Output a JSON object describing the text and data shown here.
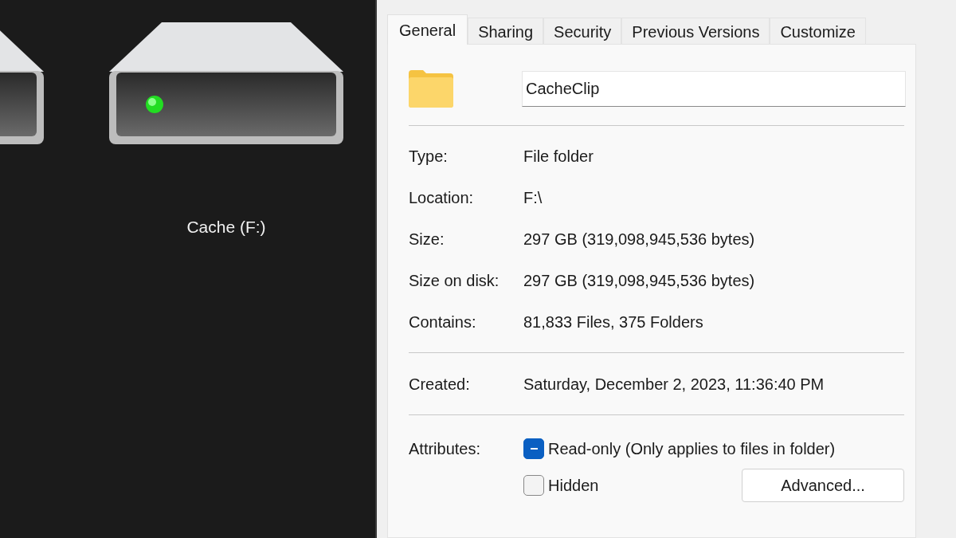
{
  "drives": [
    {
      "label": "Cache (F:)"
    }
  ],
  "dialog": {
    "tabs": [
      {
        "label": "General",
        "selected": true
      },
      {
        "label": "Sharing",
        "selected": false
      },
      {
        "label": "Security",
        "selected": false
      },
      {
        "label": "Previous Versions",
        "selected": false
      },
      {
        "label": "Customize",
        "selected": false
      }
    ],
    "name_field": {
      "value": "CacheClip"
    },
    "properties": [
      {
        "label": "Type:",
        "value": "File folder"
      },
      {
        "label": "Location:",
        "value": "F:\\"
      },
      {
        "label": "Size:",
        "value": "297 GB (319,098,945,536 bytes)"
      },
      {
        "label": "Size on disk:",
        "value": "297 GB (319,098,945,536 bytes)"
      },
      {
        "label": "Contains:",
        "value": "81,833 Files, 375 Folders"
      }
    ],
    "dates": [
      {
        "label": "Created:",
        "value": "Saturday, December 2, 2023, 11:36:40 PM"
      }
    ],
    "attributes": {
      "label": "Attributes:",
      "items": [
        {
          "label": "Read-only (Only applies to files in folder)",
          "checked": true,
          "mixed": true
        },
        {
          "label": "Hidden",
          "checked": false,
          "mixed": false
        }
      ],
      "advanced_button": "Advanced..."
    }
  }
}
